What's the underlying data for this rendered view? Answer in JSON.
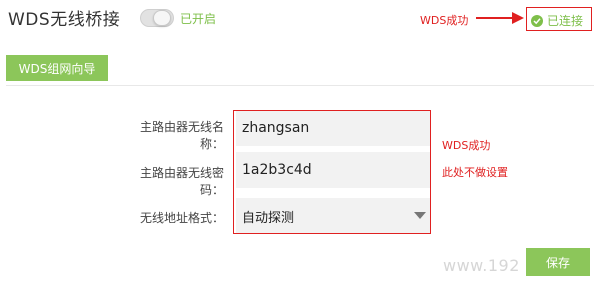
{
  "header": {
    "title": "WDS无线桥接",
    "toggle_state": "已开启"
  },
  "annotations": {
    "top": "WDS成功",
    "middle_line1": "WDS成功",
    "middle_line2": "此处不做设置"
  },
  "status": {
    "label": "已连接"
  },
  "toolbar": {
    "wizard_label": "WDS组网向导",
    "save_label": "保存"
  },
  "form": {
    "ssid_label": "主路由器无线名称：",
    "ssid_value": "zhangsan",
    "password_label": "主路由器无线密码：",
    "password_value": "1a2b3c4d",
    "format_label": "无线地址格式：",
    "format_value": "自动探测"
  },
  "watermark": "www.192",
  "colors": {
    "accent_green": "#8cc65a",
    "annotation_red": "#e02020"
  }
}
